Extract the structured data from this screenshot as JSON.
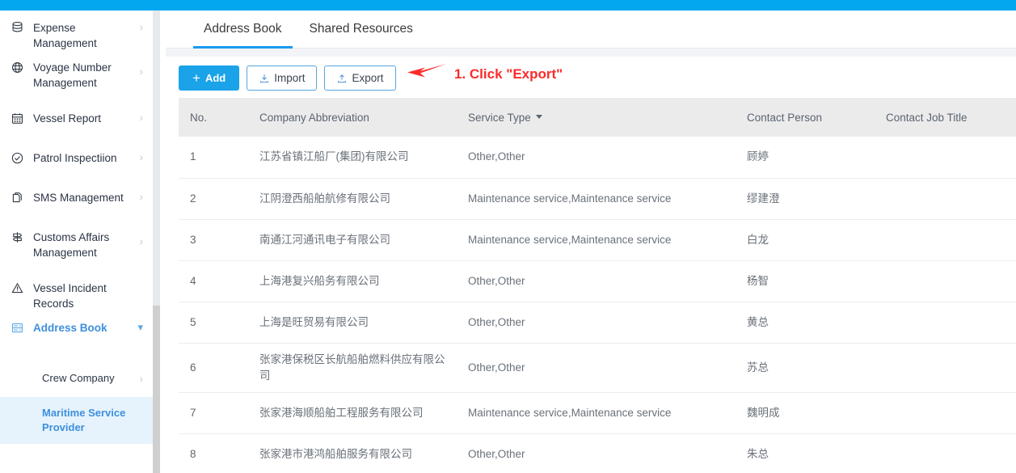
{
  "theme": {
    "topbar_color": "#02a7f0",
    "accent_color": "#1a9bf0",
    "primary_button_color": "#1aa3e8",
    "annotation_color": "#fc2b2b",
    "selected_item_bg": "#e6f3fc",
    "table_header_bg": "#ebebeb"
  },
  "sidebar": {
    "items": [
      {
        "label": "Expense Management",
        "icon": "database-icon",
        "arrow": "chevron-right-icon",
        "active": false
      },
      {
        "label": "Voyage Number\nManagement",
        "icon": "globe-icon",
        "arrow": "chevron-right-icon",
        "active": false
      },
      {
        "label": "Vessel Report",
        "icon": "calendar-icon",
        "arrow": "chevron-right-icon",
        "active": false
      },
      {
        "label": "Patrol Inspectiion",
        "icon": "check-circle-icon",
        "arrow": "chevron-right-icon",
        "active": false
      },
      {
        "label": "SMS Management",
        "icon": "documents-icon",
        "arrow": "chevron-right-icon",
        "active": false
      },
      {
        "label": "Customs Affairs\nManagement",
        "icon": "signpost-icon",
        "arrow": "chevron-right-icon",
        "active": false
      },
      {
        "label": "Vessel Incident Records",
        "icon": "warning-triangle-icon",
        "arrow": "",
        "active": false
      },
      {
        "label": "Address Book",
        "icon": "address-book-icon",
        "arrow": "chevron-down-icon",
        "active": true
      }
    ],
    "sub_items": [
      {
        "label": "Crew Company",
        "arrow": "chevron-right-icon",
        "selected": false
      },
      {
        "label": "Maritime Service\nProvider",
        "arrow": "",
        "selected": true
      }
    ]
  },
  "tabs": [
    {
      "label": "Address Book",
      "active": true
    },
    {
      "label": "Shared Resources",
      "active": false
    }
  ],
  "toolbar": {
    "add_label": "Add",
    "add_plus": "+",
    "import_label": "Import",
    "import_icon": "download-icon",
    "export_label": "Export",
    "export_icon": "upload-icon"
  },
  "annotation": {
    "text": "1. Click \"Export\"",
    "arrow_icon": "left-arrow-icon"
  },
  "table": {
    "columns": [
      {
        "key": "no",
        "label": "No.",
        "sortable": false
      },
      {
        "key": "company",
        "label": "Company Abbreviation",
        "sortable": false
      },
      {
        "key": "service_type",
        "label": "Service Type",
        "sortable": true
      },
      {
        "key": "contact_person",
        "label": "Contact Person",
        "sortable": false
      },
      {
        "key": "contact_job_title",
        "label": "Contact Job Title",
        "sortable": false
      }
    ],
    "rows": [
      {
        "no": "1",
        "company": "江苏省镇江船厂(集团)有限公司",
        "service_type": "Other,Other",
        "contact_person": "顾婷",
        "contact_job_title": ""
      },
      {
        "no": "2",
        "company": "江阴澄西船舶航修有限公司",
        "service_type": "Maintenance service,Maintenance service",
        "contact_person": "缪建澄",
        "contact_job_title": ""
      },
      {
        "no": "3",
        "company": "南通江河通讯电子有限公司",
        "service_type": "Maintenance service,Maintenance service",
        "contact_person": "白龙",
        "contact_job_title": ""
      },
      {
        "no": "4",
        "company": "上海港复兴船务有限公司",
        "service_type": "Other,Other",
        "contact_person": "杨智",
        "contact_job_title": ""
      },
      {
        "no": "5",
        "company": "上海是旺贸易有限公司",
        "service_type": "Other,Other",
        "contact_person": "黄总",
        "contact_job_title": ""
      },
      {
        "no": "6",
        "company": "张家港保税区长航船舶燃料供应有限公司",
        "service_type": "Other,Other",
        "contact_person": "苏总",
        "contact_job_title": ""
      },
      {
        "no": "7",
        "company": "张家港海顺船舶工程服务有限公司",
        "service_type": "Maintenance service,Maintenance service",
        "contact_person": "魏明成",
        "contact_job_title": ""
      },
      {
        "no": "8",
        "company": "张家港市港鸿船舶服务有限公司",
        "service_type": "Other,Other",
        "contact_person": "朱总",
        "contact_job_title": ""
      }
    ]
  }
}
